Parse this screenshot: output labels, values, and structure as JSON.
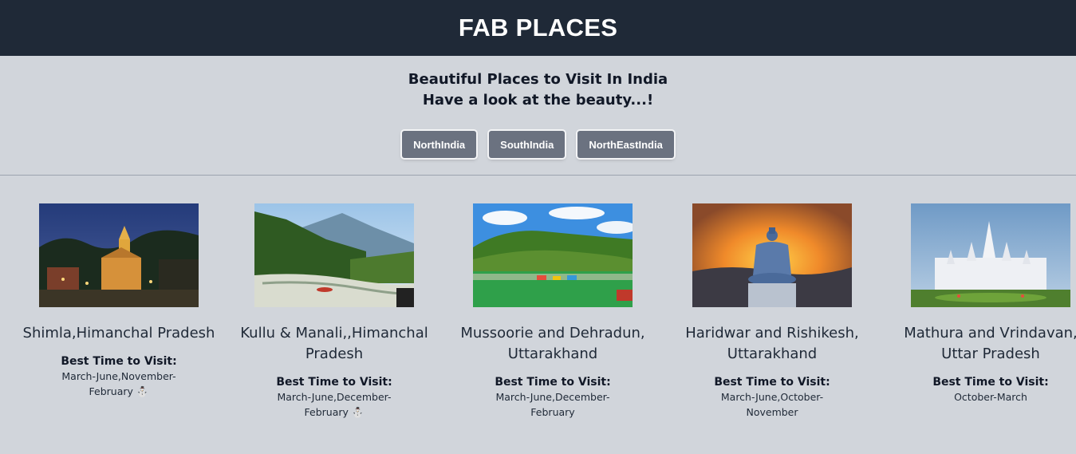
{
  "header": {
    "title": "FAB PLACES"
  },
  "intro": {
    "line1": "Beautiful Places to Visit In India",
    "line2": "Have a look at the beauty...!"
  },
  "regions": [
    {
      "label": "NorthIndia"
    },
    {
      "label": "SouthIndia"
    },
    {
      "label": "NorthEastIndia"
    }
  ],
  "best_time_label": "Best Time to Visit:",
  "places": [
    {
      "name": "Shimla,Himanchal Pradesh",
      "months": "March-June,November-February ⛄"
    },
    {
      "name": "Kullu & Manali,,Himanchal Pradesh",
      "months": "March-June,December-February ⛄"
    },
    {
      "name": "Mussoorie and Dehradun, Uttarakhand",
      "months": "March-June,December-February"
    },
    {
      "name": "Haridwar and Rishikesh, Uttarakhand",
      "months": "March-June,October-November"
    },
    {
      "name": "Mathura and Vrindavan, Uttar Pradesh",
      "months": "October-March"
    }
  ],
  "colors": {
    "header_bg": "#1f2937",
    "page_bg": "#d1d5db",
    "button_bg": "#6b7280"
  }
}
